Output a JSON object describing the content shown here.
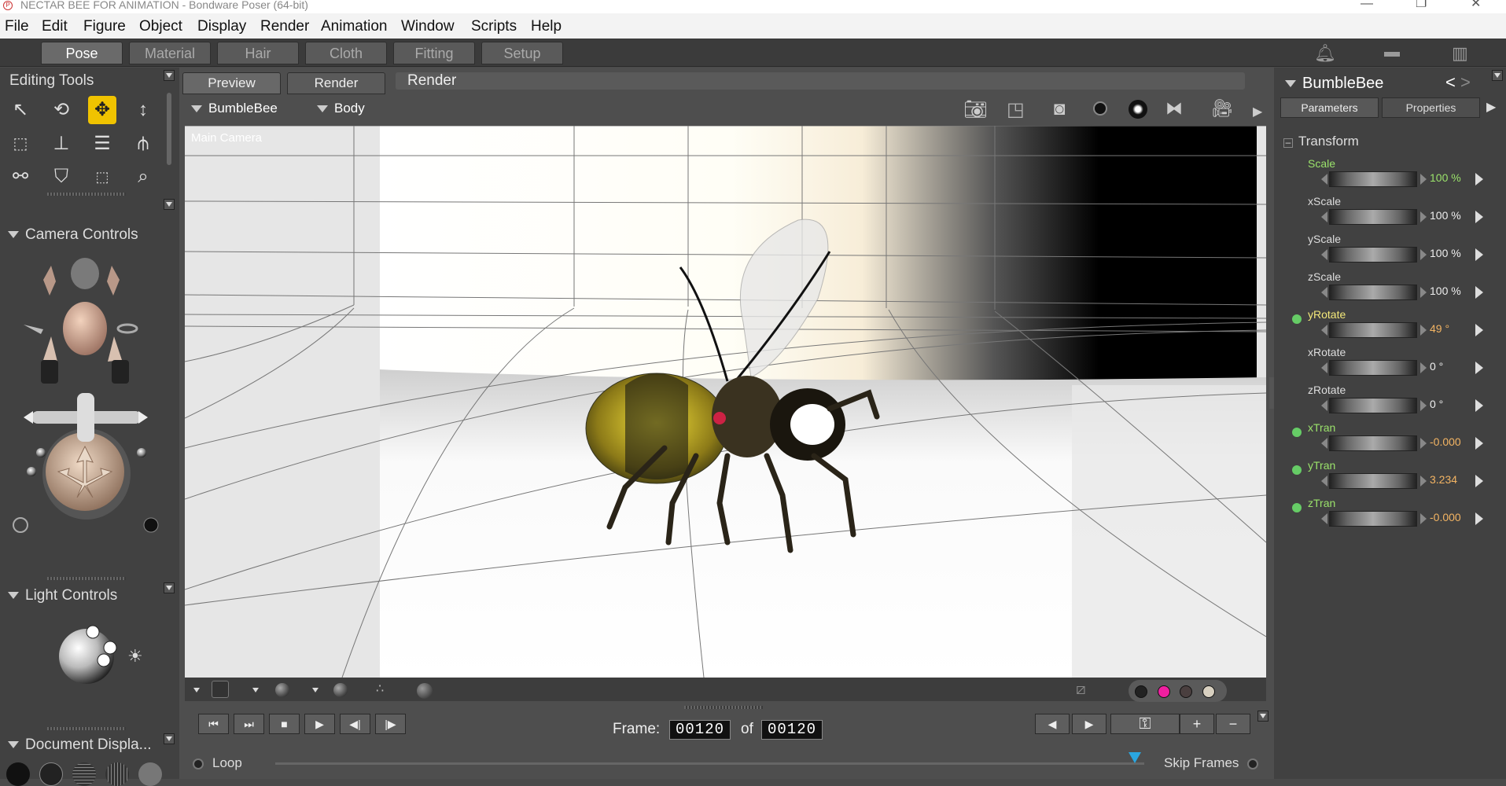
{
  "window": {
    "title": "NECTAR BEE FOR ANIMATION - Bondware Poser (64-bit)",
    "logo": "P"
  },
  "menu": [
    "File",
    "Edit",
    "Figure",
    "Object",
    "Display",
    "Render",
    "Animation",
    "Window",
    "Scripts",
    "Help"
  ],
  "rooms": {
    "tabs": [
      "Pose",
      "Material",
      "Hair",
      "Cloth",
      "Fitting",
      "Setup"
    ],
    "active": "Pose"
  },
  "top_icons": [
    "bell-icon",
    "chat-icon",
    "library-icon"
  ],
  "editing_tools": {
    "title": "Editing Tools",
    "active": "translate-tool"
  },
  "camera_controls": {
    "title": "Camera Controls"
  },
  "light_controls": {
    "title": "Light Controls"
  },
  "document_display": {
    "title": "Document Displa..."
  },
  "viewport": {
    "tabs": [
      "Preview",
      "Render"
    ],
    "render_label": "Render",
    "figure_select": "BumbleBee",
    "part_select": "Body",
    "camera_label": "Main Camera"
  },
  "timeline": {
    "frame_label": "Frame:",
    "current_frame": "00120",
    "of_label": "of",
    "total_frames": "00120",
    "loop_label": "Loop",
    "skip_frames_label": "Skip Frames",
    "scrub_position": 1.0
  },
  "colors": {
    "accent": "#f0c300",
    "keyed_dot": "#66cc66",
    "value_green": "#9be36b",
    "value_orange": "#f3b463"
  },
  "parameters": {
    "figure_name": "BumbleBee",
    "tabs": [
      "Parameters",
      "Properties"
    ],
    "group": "Transform",
    "items": [
      {
        "label": "Scale",
        "value": "100 %",
        "keyed": false,
        "highlight": "green"
      },
      {
        "label": "xScale",
        "value": "100 %",
        "keyed": false,
        "highlight": "none"
      },
      {
        "label": "yScale",
        "value": "100 %",
        "keyed": false,
        "highlight": "none"
      },
      {
        "label": "zScale",
        "value": "100 %",
        "keyed": false,
        "highlight": "none"
      },
      {
        "label": "yRotate",
        "value": "49 °",
        "keyed": true,
        "highlight": "yellow"
      },
      {
        "label": "xRotate",
        "value": "0 °",
        "keyed": false,
        "highlight": "none"
      },
      {
        "label": "zRotate",
        "value": "0 °",
        "keyed": false,
        "highlight": "none"
      },
      {
        "label": "xTran",
        "value": "-0.000",
        "keyed": true,
        "highlight": "green"
      },
      {
        "label": "yTran",
        "value": "3.234",
        "keyed": true,
        "highlight": "green"
      },
      {
        "label": "zTran",
        "value": "-0.000",
        "keyed": true,
        "highlight": "green"
      }
    ]
  }
}
